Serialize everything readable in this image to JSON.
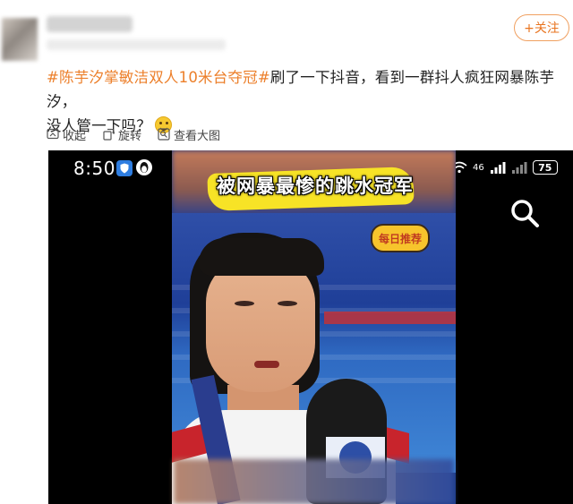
{
  "post": {
    "follow_label": "+关注",
    "hashtag": "#陈芋汐掌敏洁双人10米台夺冠#",
    "text_part1": "刷了一下抖音，看到一群抖人疯狂网暴陈芋汐，",
    "text_part2": "没人管一下吗？",
    "emoji": "smile-emoji"
  },
  "toolbar": {
    "collapse_label": "收起",
    "rotate_label": "旋转",
    "view_large_label": "查看大图"
  },
  "phone_status": {
    "time": "8:50",
    "network": "46",
    "battery": "75"
  },
  "video": {
    "caption": "被网暴最惨的跳水冠军",
    "station_logo": "每日推荐"
  },
  "colors": {
    "hashtag": "#ec7f2a",
    "follow_border": "#f0a060",
    "caption_bg": "#f7e326"
  },
  "icons": [
    "collapse-icon",
    "rotate-icon",
    "view-large-icon",
    "search-icon",
    "wifi-icon",
    "signal-icon"
  ]
}
